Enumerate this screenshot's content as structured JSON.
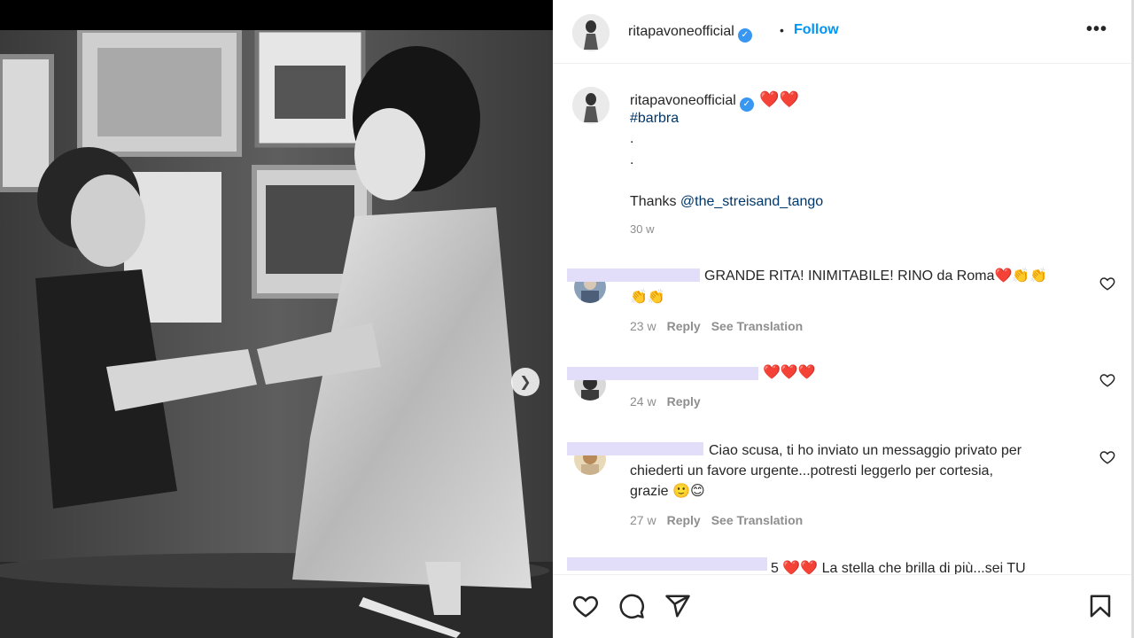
{
  "post": {
    "username": "ritapavoneofficial",
    "follow_label": "Follow",
    "separator": "•",
    "more_label": "•••"
  },
  "caption": {
    "username": "ritapavoneofficial",
    "hearts": "❤️❤️",
    "hashtag": "#barbra",
    "dot1": ".",
    "dot2": ".",
    "thanks_prefix": "Thanks ",
    "mention": "@the_streisand_tango",
    "time": "30 w"
  },
  "comments": [
    {
      "text": "GRANDE RITA! INIMITABILE! RINO da Roma❤️👏👏",
      "text_line2": "👏👏",
      "time": "23 w",
      "reply": "Reply",
      "translate": "See Translation"
    },
    {
      "text": "❤️❤️❤️",
      "time": "24 w",
      "reply": "Reply"
    },
    {
      "text_line1": "Ciao scusa, ti ho inviato un messaggio privato per",
      "text_line2": "chiederti un favore urgente...potresti leggerlo per cortesia,",
      "text_line3": "grazie 🙂😊",
      "time": "27 w",
      "reply": "Reply",
      "translate": "See Translation"
    },
    {
      "text": "5 ❤️❤️ La stella che brilla di più...sei TU"
    }
  ],
  "icons": {
    "like": "heart-icon",
    "comment": "comment-icon",
    "share": "share-icon",
    "save": "bookmark-icon",
    "next": "chevron-right-icon"
  }
}
